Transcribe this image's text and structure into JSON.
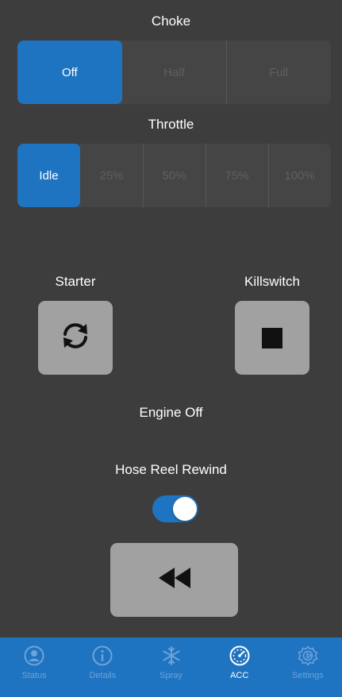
{
  "choke": {
    "title": "Choke",
    "options": [
      "Off",
      "Half",
      "Full"
    ],
    "selected": "Off"
  },
  "throttle": {
    "title": "Throttle",
    "options": [
      "Idle",
      "25%",
      "50%",
      "75%",
      "100%"
    ],
    "selected": "Idle"
  },
  "controls": {
    "starter_label": "Starter",
    "killswitch_label": "Killswitch",
    "starter_icon": "refresh-icon",
    "killswitch_icon": "stop-icon"
  },
  "engine_status": "Engine Off",
  "hose_reel": {
    "title": "Hose Reel Rewind",
    "toggle_on": true,
    "rewind_icon": "rewind-icon"
  },
  "tab_bar": {
    "tabs": [
      {
        "label": "Status",
        "icon": "user-circle-icon"
      },
      {
        "label": "Details",
        "icon": "info-circle-icon"
      },
      {
        "label": "Spray",
        "icon": "snowflake-icon"
      },
      {
        "label": "ACC",
        "icon": "gauge-icon"
      },
      {
        "label": "Settings",
        "icon": "gear-icon"
      }
    ],
    "active": "ACC"
  },
  "colors": {
    "background": "#3d3d3d",
    "accent": "#1f74c1",
    "segment_bg": "#454545",
    "segment_text_inactive": "#5f5f5f",
    "button_bg": "#a1a1a1",
    "tab_inactive": "#6ea3d8"
  }
}
